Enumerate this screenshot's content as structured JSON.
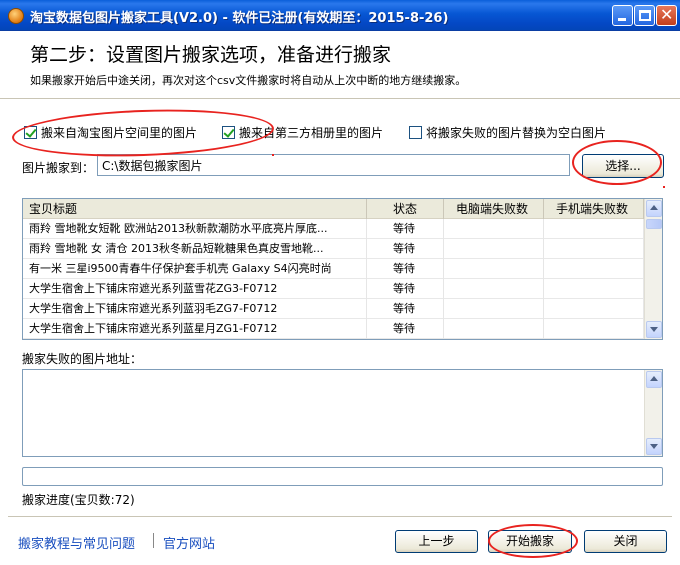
{
  "window": {
    "title": "淘宝数据包图片搬家工具(V2.0) - 软件已注册(有效期至：2015-8-26)",
    "icon": "app-icon"
  },
  "header": {
    "step_title": "第二步：设置图片搬家选项，准备进行搬家",
    "description": "如果搬家开始后中途关闭，再次对这个csv文件搬家时将自动从上次中断的地方继续搬家。"
  },
  "options": {
    "taobao_space": {
      "label": "搬来自淘宝图片空间里的图片",
      "checked": true
    },
    "third_party": {
      "label": "搬来自第三方相册里的图片",
      "checked": true
    },
    "replace_failed": {
      "label": "将搬家失败的图片替换为空白图片",
      "checked": false
    }
  },
  "destination": {
    "label": "图片搬家到：",
    "value": "C:\\数据包搬家图片",
    "choose_button": "选择..."
  },
  "table": {
    "columns": [
      "宝贝标题",
      "状态",
      "电脑端失败数",
      "手机端失败数"
    ],
    "rows": [
      {
        "title": "雨羚 雪地靴女短靴 欧洲站2013秋新款潮防水平底亮片厚底...",
        "status": "等待",
        "pc_fail": "",
        "mobile_fail": ""
      },
      {
        "title": "雨羚 雪地靴 女 清仓 2013秋冬新品短靴糖果色真皮雪地靴...",
        "status": "等待",
        "pc_fail": "",
        "mobile_fail": ""
      },
      {
        "title": "有一米 三星i9500青春牛仔保护套手机壳 Galaxy S4闪亮时尚",
        "status": "等待",
        "pc_fail": "",
        "mobile_fail": ""
      },
      {
        "title": "大学生宿舍上下铺床帘遮光系列蓝雪花ZG3-F0712",
        "status": "等待",
        "pc_fail": "",
        "mobile_fail": ""
      },
      {
        "title": "大学生宿舍上下铺床帘遮光系列蓝羽毛ZG7-F0712",
        "status": "等待",
        "pc_fail": "",
        "mobile_fail": ""
      },
      {
        "title": "大学生宿舍上下铺床帘遮光系列蓝星月ZG1-F0712",
        "status": "等待",
        "pc_fail": "",
        "mobile_fail": ""
      }
    ]
  },
  "failed": {
    "label": "搬家失败的图片地址："
  },
  "progress": {
    "label": "搬家进度(宝贝数:72)",
    "value": 0
  },
  "footer": {
    "help_link": "搬家教程与常见问题",
    "site_link": "官方网站",
    "prev_button": "上一步",
    "start_button": "开始搬家",
    "close_button": "关闭"
  },
  "colors": {
    "titlebar": "#0757d4",
    "annotation": "#e8231f",
    "link": "#1a4fbf"
  }
}
